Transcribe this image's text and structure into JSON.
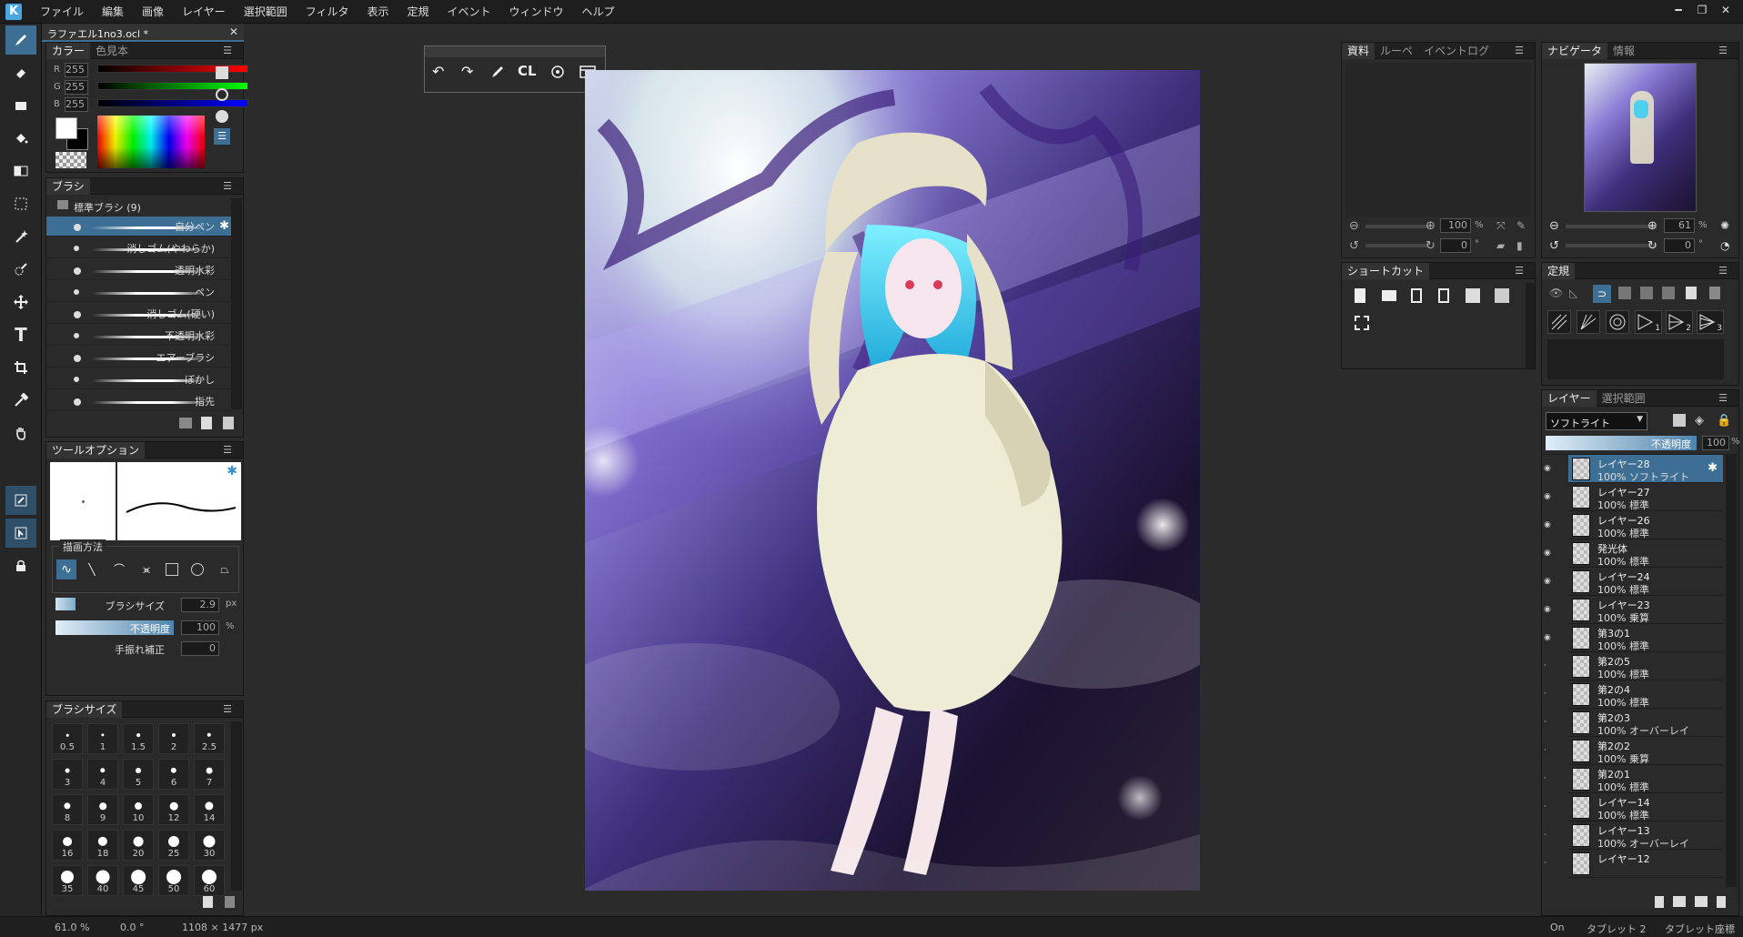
{
  "app": {
    "logo": "K"
  },
  "menu": [
    "ファイル",
    "編集",
    "画像",
    "レイヤー",
    "選択範囲",
    "フィルタ",
    "表示",
    "定規",
    "イベント",
    "ウィンドウ",
    "ヘルプ"
  ],
  "window_controls": {
    "minimize": "━",
    "restore": "❐",
    "close": "✕"
  },
  "document_tab": {
    "title": "ラファエル1no3.ocl *",
    "close": "✕"
  },
  "color_panel": {
    "tabs": [
      "カラー",
      "色見本"
    ],
    "channels": [
      {
        "label": "R",
        "value": "255"
      },
      {
        "label": "G",
        "value": "255"
      },
      {
        "label": "B",
        "value": "255"
      }
    ]
  },
  "brush_panel": {
    "tab": "ブラシ",
    "group": "標準ブラシ (9)",
    "items": [
      "自分ペン",
      "消しゴム(やわらか)",
      "透明水彩",
      "ペン",
      "消しゴム(硬い)",
      "不透明水彩",
      "エアーブラシ",
      "ぼかし",
      "指先"
    ]
  },
  "tool_options": {
    "tab": "ツールオプション",
    "draw_method_label": "描画方法",
    "brush_size_label": "ブラシサイズ",
    "brush_size_value": "2.9",
    "brush_size_unit": "px",
    "opacity_label": "不透明度",
    "opacity_value": "100",
    "opacity_unit": "%",
    "stabilizer_label": "手振れ補正",
    "stabilizer_value": "0"
  },
  "brush_size_panel": {
    "tab": "ブラシサイズ",
    "sizes": [
      "0.5",
      "1",
      "1.5",
      "2",
      "2.5",
      "3",
      "4",
      "5",
      "6",
      "7",
      "8",
      "9",
      "10",
      "12",
      "14",
      "16",
      "18",
      "20",
      "25",
      "30",
      "35",
      "40",
      "45",
      "50",
      "60"
    ]
  },
  "floating_toolbar": {
    "cl_label": "CL"
  },
  "material_panel": {
    "tabs": [
      "資料",
      "ルーペ",
      "イベントログ"
    ],
    "zoom_value": "100",
    "zoom_unit": "%",
    "rotate_value": "0",
    "rotate_unit": "°"
  },
  "navigator_panel": {
    "tabs": [
      "ナビゲータ",
      "情報"
    ],
    "zoom_value": "61",
    "zoom_unit": "%",
    "rotate_value": "0",
    "rotate_unit": "°"
  },
  "shortcut_panel": {
    "tab": "ショートカット"
  },
  "ruler_panel": {
    "tab": "定規",
    "sub": [
      "1",
      "2",
      "3"
    ]
  },
  "layer_panel": {
    "tabs": [
      "レイヤー",
      "選択範囲"
    ],
    "blend_mode": "ソフトライト",
    "opacity_label": "不透明度",
    "opacity_value": "100",
    "opacity_unit": "%",
    "layers": [
      {
        "name": "レイヤー28",
        "mode": "100% ソフトライト",
        "selected": true
      },
      {
        "name": "レイヤー27",
        "mode": "100% 標準"
      },
      {
        "name": "レイヤー26",
        "mode": "100% 標準"
      },
      {
        "name": "発光体",
        "mode": "100% 標準"
      },
      {
        "name": "レイヤー24",
        "mode": "100% 標準"
      },
      {
        "name": "レイヤー23",
        "mode": "100% 乗算"
      },
      {
        "name": "第3の1",
        "mode": "100% 標準"
      },
      {
        "name": "第2の5",
        "mode": "100% 標準"
      },
      {
        "name": "第2の4",
        "mode": "100% 標準"
      },
      {
        "name": "第2の3",
        "mode": "100% オーバーレイ"
      },
      {
        "name": "第2の2",
        "mode": "100% 乗算"
      },
      {
        "name": "第2の1",
        "mode": "100% 標準"
      },
      {
        "name": "レイヤー14",
        "mode": "100% 標準"
      },
      {
        "name": "レイヤー13",
        "mode": "100% オーバーレイ"
      },
      {
        "name": "レイヤー12",
        "mode": ""
      }
    ]
  },
  "status": {
    "zoom": "61.0 %",
    "angle": "0.0 °",
    "size": "1108 × 1477 px",
    "on": "On",
    "tablet": "タブレット 2",
    "tablet_coord": "タブレット座標"
  },
  "colors": {
    "accent": "#3d6f95",
    "panel": "#2a2a2a",
    "workspace": "#2b2b2b"
  }
}
